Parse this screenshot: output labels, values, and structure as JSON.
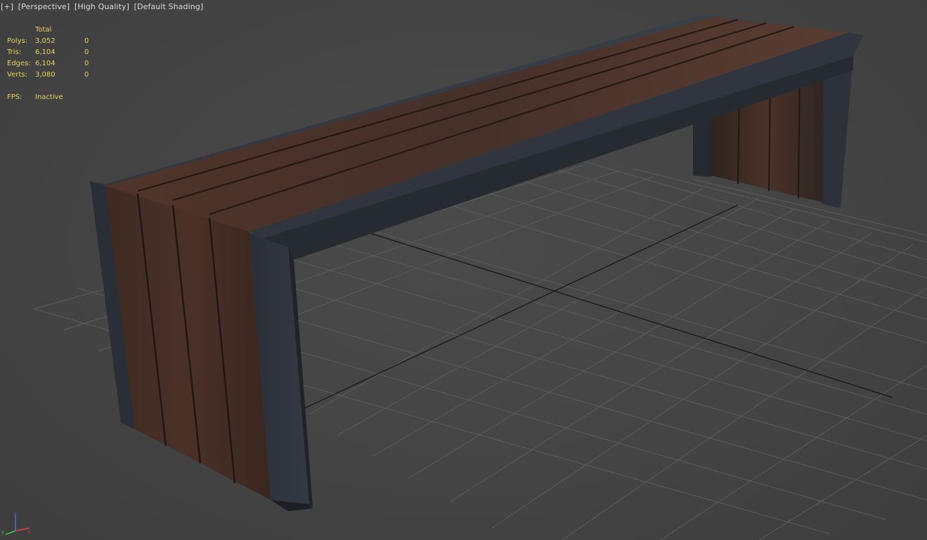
{
  "viewport": {
    "labels": [
      "[+]",
      "[Perspective]",
      "[High Quality]",
      "[Default Shading]"
    ]
  },
  "stats": {
    "header": "Total",
    "rows": [
      {
        "label": "Polys:",
        "total": "3,052",
        "selected": "0"
      },
      {
        "label": "Tris:",
        "total": "6,104",
        "selected": "0"
      },
      {
        "label": "Edges:",
        "total": "6,104",
        "selected": "0"
      },
      {
        "label": "Verts:",
        "total": "3,080",
        "selected": "0"
      }
    ],
    "fps_label": "FPS:",
    "fps_value": "Inactive"
  },
  "gizmo": {
    "axes": [
      "x",
      "y",
      "z"
    ],
    "colors": {
      "x": "#e03a3a",
      "y": "#3acb4a",
      "z": "#4a6ae8"
    }
  },
  "colors": {
    "background": "#444444",
    "grid": "#5c5c5c",
    "grid_axis": "#111111",
    "stats_text": "#e8d25a",
    "label_text": "#dcdcdc",
    "frame_metal": "#2c313a",
    "wood": "#4a3128"
  }
}
